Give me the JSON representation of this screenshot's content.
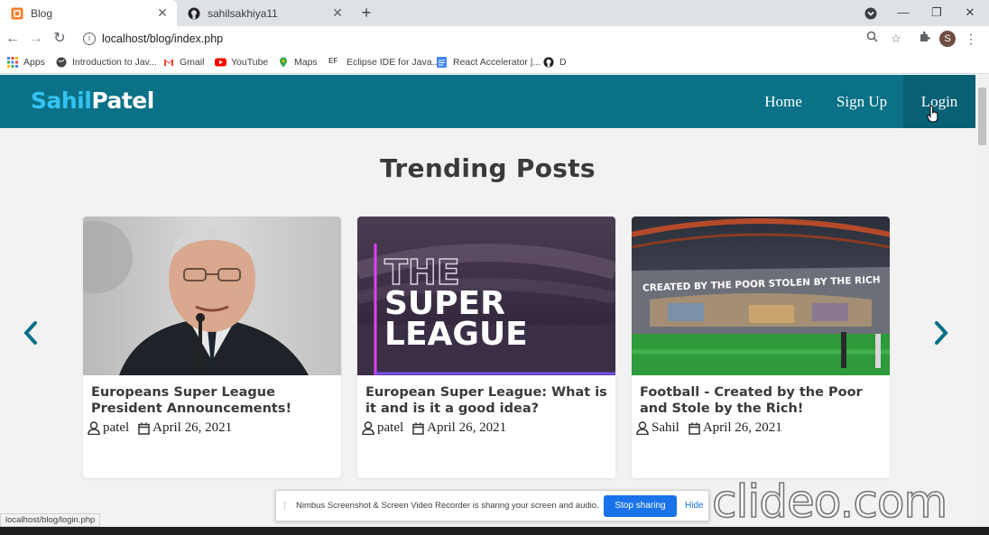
{
  "browser": {
    "tabs": [
      {
        "title": "Blog",
        "icon": "blog-favicon-icon",
        "active": true
      },
      {
        "title": "sahilsakhiya11",
        "icon": "github-icon",
        "active": false
      }
    ],
    "address": "localhost/blog/index.php",
    "profile_initial": "S",
    "bookmarks": [
      {
        "label": "Apps",
        "icon": "apps-grid-icon"
      },
      {
        "label": "Introduction to Jav...",
        "icon": "globe-icon"
      },
      {
        "label": "Gmail",
        "icon": "gmail-icon"
      },
      {
        "label": "YouTube",
        "icon": "youtube-icon"
      },
      {
        "label": "Maps",
        "icon": "maps-pin-icon"
      },
      {
        "label": "Eclipse IDE for Java...",
        "icon": "eclipse-icon"
      },
      {
        "label": "React Accelerator |...",
        "icon": "doc-icon"
      },
      {
        "label": "D",
        "icon": "github-icon"
      }
    ]
  },
  "site": {
    "logo_part1": "Sahil",
    "logo_part2": "Patel",
    "nav": [
      {
        "label": "Home"
      },
      {
        "label": "Sign Up"
      },
      {
        "label": "Login"
      }
    ],
    "heading": "Trending Posts",
    "posts": [
      {
        "title": "Europeans Super League President Announcements!",
        "author": "patel",
        "date": "April 26, 2021",
        "image": "man-portrait-photo"
      },
      {
        "title": "European Super League: What is it and is it a good idea?",
        "author": "patel",
        "date": "April 26, 2021",
        "image": "the-super-league-graphic",
        "image_text": [
          "THE",
          "SUPER",
          "LEAGUE"
        ]
      },
      {
        "title": "Football - Created by the Poor and Stole by the Rich!",
        "author": "Sahil",
        "date": "April 26, 2021",
        "image": "stadium-banner-photo",
        "image_text": "CREATED BY THE POOR STOLEN BY THE RICH"
      }
    ]
  },
  "status_url": "localhost/blog/login.php",
  "screen_share": {
    "message": "Nimbus Screenshot & Screen Video Recorder is sharing your screen and audio.",
    "stop_label": "Stop sharing",
    "hide_label": "Hide"
  },
  "watermark": "clideo.com",
  "colors": {
    "header": "#0a7187",
    "logo_accent": "#34c3f0",
    "arrow": "#0a7187"
  }
}
